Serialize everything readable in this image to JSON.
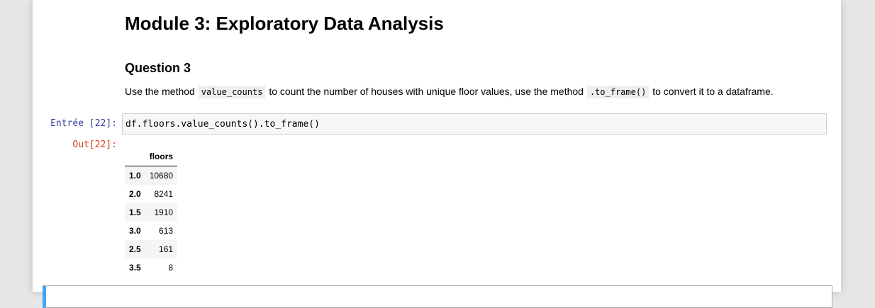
{
  "markdown": {
    "heading": "Module 3: Exploratory Data Analysis",
    "question": "Question 3",
    "text_1": "Use the method ",
    "code_1": "value_counts",
    "text_2": " to count the number of houses with unique floor values, use the method ",
    "code_2": ".to_frame()",
    "text_3": " to convert it to a dataframe."
  },
  "cell": {
    "in_prompt": "Entrée [22]:",
    "code": "df.floors.value_counts().to_frame()",
    "out_prompt": "Out[22]:"
  },
  "dataframe": {
    "index_header": "",
    "column": "floors",
    "rows": [
      {
        "index": "1.0",
        "value": "10680"
      },
      {
        "index": "2.0",
        "value": "8241"
      },
      {
        "index": "1.5",
        "value": "1910"
      },
      {
        "index": "3.0",
        "value": "613"
      },
      {
        "index": "2.5",
        "value": "161"
      },
      {
        "index": "3.5",
        "value": "8"
      }
    ]
  },
  "colors": {
    "in_prompt": "#303f9f",
    "out_prompt": "#d84315",
    "selected_cell_bar": "#42a5f5"
  }
}
